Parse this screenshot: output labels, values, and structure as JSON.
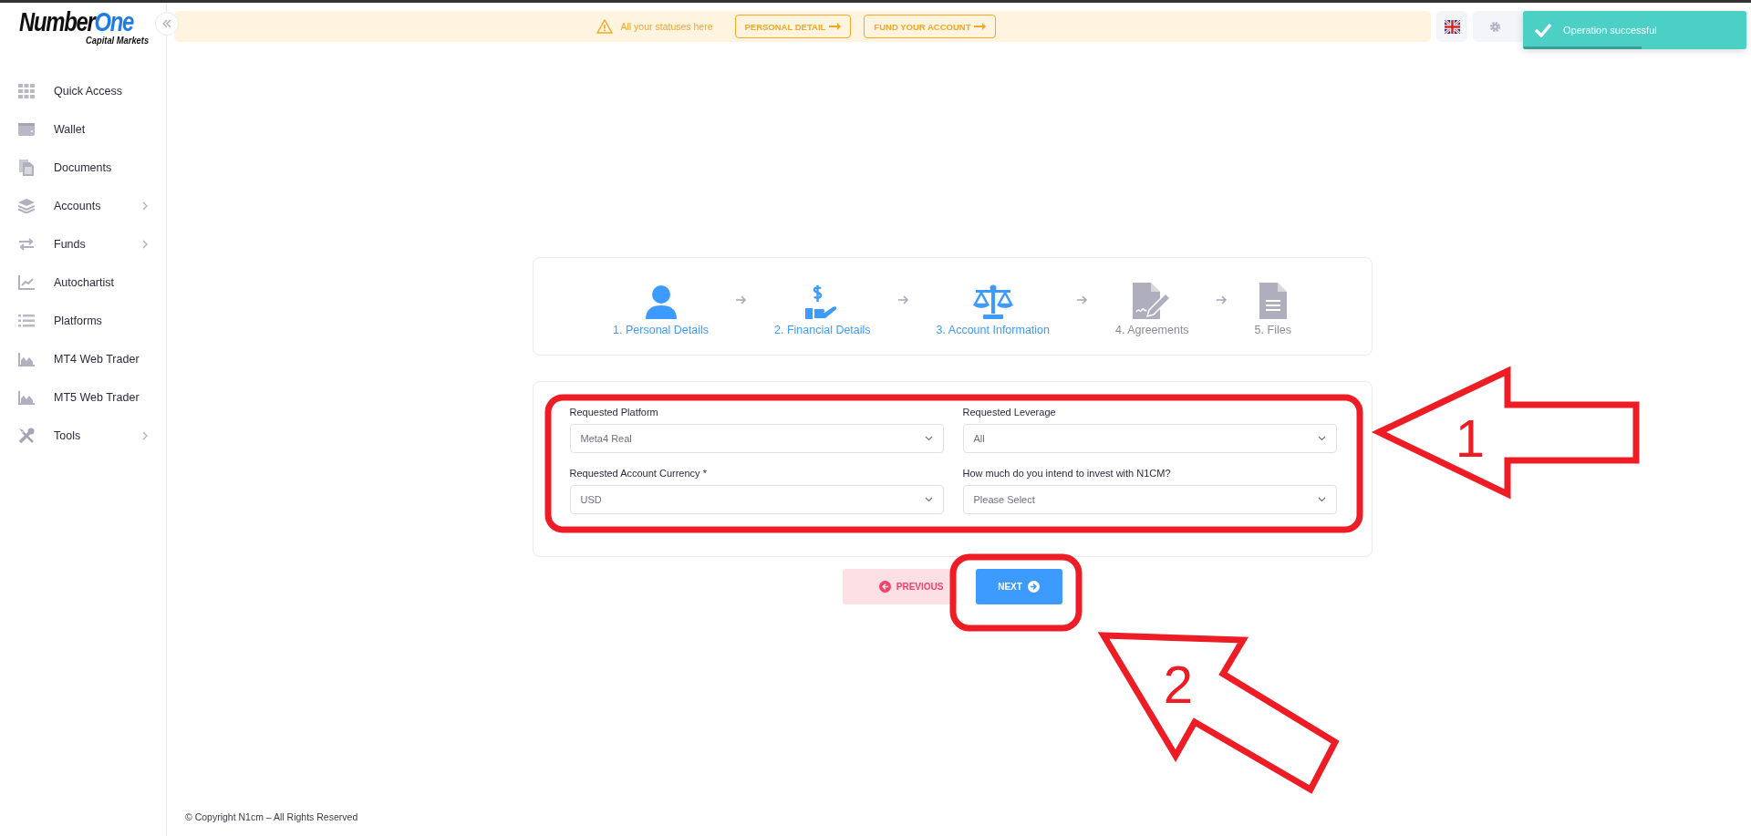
{
  "logo": {
    "brand_a": "Number",
    "brand_b": "One",
    "tagline": "Capital Markets"
  },
  "sidebar": {
    "items": [
      {
        "label": "Quick Access",
        "expandable": false
      },
      {
        "label": "Wallet",
        "expandable": false
      },
      {
        "label": "Documents",
        "expandable": false
      },
      {
        "label": "Accounts",
        "expandable": true
      },
      {
        "label": "Funds",
        "expandable": true
      },
      {
        "label": "Autochartist",
        "expandable": false
      },
      {
        "label": "Platforms",
        "expandable": false
      },
      {
        "label": "MT4 Web Trader",
        "expandable": false
      },
      {
        "label": "MT5 Web Trader",
        "expandable": false
      },
      {
        "label": "Tools",
        "expandable": true
      }
    ]
  },
  "top_bar": {
    "status_message": "All your statuses here",
    "buttons": [
      "PERSONAL DETAIL",
      "FUND YOUR ACCOUNT"
    ]
  },
  "toast": {
    "message": "Operation successful",
    "level": 0.53
  },
  "steps": [
    {
      "label": "1. Personal Details",
      "active": true
    },
    {
      "label": "2. Financial Details",
      "active": true
    },
    {
      "label": "3. Account Information",
      "active": true
    },
    {
      "label": "4. Agreements",
      "active": false
    },
    {
      "label": "5. Files",
      "active": false
    }
  ],
  "form": {
    "fields": [
      {
        "label": "Requested Platform",
        "value": "Meta4 Real"
      },
      {
        "label": "Requested Leverage",
        "value": "All"
      },
      {
        "label": "Requested Account Currency *",
        "value": "USD"
      },
      {
        "label": "How much do you intend to invest with N1CM?",
        "value": "Please Select"
      }
    ]
  },
  "buttons": [
    {
      "label": "PREVIOUS",
      "kind": "previous"
    },
    {
      "label": "NEXT",
      "kind": "next"
    }
  ],
  "footer": "© Copyright N1cm – All Rights Reserved",
  "annotations": [
    {
      "number": "1"
    },
    {
      "number": "2"
    }
  ]
}
